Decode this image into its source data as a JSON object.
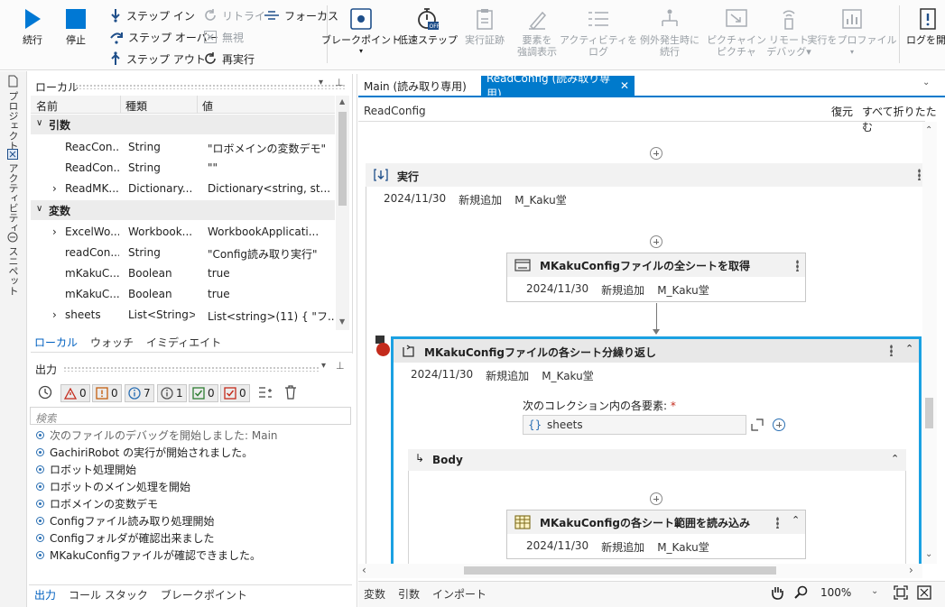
{
  "ribbon": {
    "continue": "続行",
    "stop": "停止",
    "step_in": "ステップ イン",
    "step_over": "ステップ オーバー",
    "step_out": "ステップ アウト",
    "retry": "リトライ",
    "ignore": "無視",
    "restart": "再実行",
    "focus": "フォーカス",
    "breakpoint": "ブレークポイント",
    "slow_step": "低速ステップ",
    "validate": "実行証跡",
    "highlight_1": "要素を",
    "highlight_2": "強調表示",
    "log_activity_1": "アクティビティを",
    "log_activity_2": "ログ",
    "continue_exception_1": "例外発生時に",
    "continue_exception_2": "続行",
    "picture_1": "ピクチャイン",
    "picture_2": "ピクチャ",
    "remote_1": "リモート",
    "remote_2": "デバッグ",
    "profile": "実行をプロファイル",
    "open_log": "ログを開"
  },
  "left_strip": {
    "project": "プロジェクト",
    "activity": "アクティビティ",
    "snippet": "スニペット"
  },
  "locals": {
    "title": "ローカル",
    "col_name": "名前",
    "col_type": "種類",
    "col_value": "値",
    "group_args": "引数",
    "group_vars": "変数",
    "args": [
      {
        "name": "ReacCon...",
        "type": "String",
        "value": "\"ロボメインの変数デモ\"",
        "expand": ""
      },
      {
        "name": "ReadCon...",
        "type": "String",
        "value": "\"\"",
        "expand": ""
      },
      {
        "name": "ReadMK...",
        "type": "Dictionary...",
        "value": "Dictionary<string, st...",
        "expand": "›"
      }
    ],
    "vars": [
      {
        "name": "ExcelWo...",
        "type": "Workbook...",
        "value": "WorkbookApplicati...",
        "expand": "›"
      },
      {
        "name": "readCon...",
        "type": "String",
        "value": "\"Config読み取り実行\"",
        "expand": ""
      },
      {
        "name": "mKakuC...",
        "type": "Boolean",
        "value": "true",
        "expand": ""
      },
      {
        "name": "mKakuC...",
        "type": "Boolean",
        "value": "true",
        "expand": ""
      },
      {
        "name": "sheets",
        "type": "List<String>",
        "value": "List<string>(11) { \"フ...",
        "expand": "›"
      }
    ],
    "tabs": [
      "ローカル",
      "ウォッチ",
      "イミディエイト"
    ]
  },
  "output": {
    "title": "出力",
    "counts": {
      "errors": "0",
      "warnings": "0",
      "info": "7",
      "trace": "1",
      "success": "0",
      "verbose": "0"
    },
    "search_placeholder": "検索",
    "lines": [
      "次のファイルのデバッグを開始しました: Main",
      "GachiriRobot の実行が開始されました。",
      "ロボット処理開始",
      "ロボットのメイン処理を開始",
      "ロボメインの変数デモ",
      "Configファイル読み取り処理開始",
      "Configフォルダが確認出来ました",
      "MKakuConfigファイルが確認できました。"
    ],
    "tabs": [
      "出力",
      "コール スタック",
      "ブレークポイント"
    ]
  },
  "designer": {
    "tabs": [
      {
        "label": "Main (読み取り専用)",
        "active": false
      },
      {
        "label": "ReadConfig (読み取り専用)",
        "active": true
      }
    ],
    "breadcrumb": "ReadConfig",
    "restore": "復元",
    "collapse_all": "すべて折りたたむ",
    "seq_title": "実行",
    "seq_meta": [
      "2024/11/30",
      "新規追加",
      "M_Kaku堂"
    ],
    "act1_title": "MKakuConfigファイルの全シートを取得",
    "act1_meta": [
      "2024/11/30",
      "新規追加",
      "M_Kaku堂"
    ],
    "foreach_title": "MKakuConfigファイルの各シート分繰り返し",
    "foreach_meta": [
      "2024/11/30",
      "新規追加",
      "M_Kaku堂"
    ],
    "foreach_label": "次のコレクション内の各要素:",
    "foreach_required": "*",
    "foreach_value": "sheets",
    "foreach_value_icon": "{}",
    "body_label": "Body",
    "act2_title": "MKakuConfigの各シート範囲を読み込み",
    "act2_meta": [
      "2024/11/30",
      "新規追加",
      "M_Kaku堂"
    ],
    "bottom_tabs": [
      "変数",
      "引数",
      "インポート"
    ],
    "zoom": "100%"
  },
  "colors": {
    "accent": "#0078d4",
    "active_tab": "#007acc",
    "breakpoint": "#c42b1c",
    "selected_border": "#1ba1e2"
  }
}
